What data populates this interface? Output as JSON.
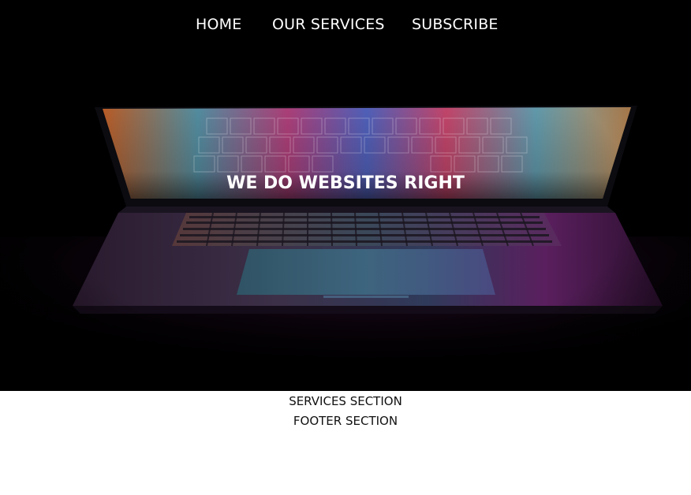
{
  "nav": {
    "items": [
      {
        "label": "HOME"
      },
      {
        "label": "OUR SERVICES"
      },
      {
        "label": "SUBSCRIBE"
      }
    ]
  },
  "hero": {
    "headline": "WE DO WEBSITES RIGHT"
  },
  "sections": {
    "services_label": "SERVICES SECTION",
    "footer_label": "FOOTER SECTION"
  },
  "colors": {
    "hero_background": "#000000",
    "nav_text": "#ffffff",
    "headline_text": "#ffffff",
    "page_background": "#ffffff",
    "section_text": "#111111"
  }
}
